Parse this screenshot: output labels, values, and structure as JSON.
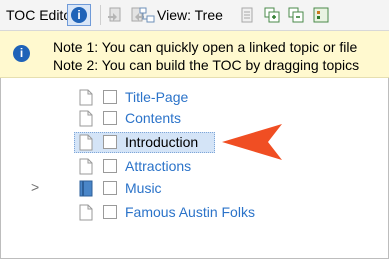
{
  "toolbar": {
    "title": "TOC Editor",
    "view_label": "View: Tree",
    "icons": [
      "info-icon",
      "topic-left-icon",
      "topic-right-icon",
      "view-tree-icon",
      "list-icon",
      "expand-icon",
      "collapse-icon"
    ]
  },
  "note": {
    "line1": "Note 1: You can quickly open a linked topic or file",
    "line2": "Note 2: You can build the TOC by dragging topics"
  },
  "tree": {
    "items": [
      {
        "label": "Title-Page",
        "icon": "document-icon",
        "selected": false,
        "expandable": false
      },
      {
        "label": "Contents",
        "icon": "document-icon",
        "selected": false,
        "expandable": false
      },
      {
        "label": "Introduction",
        "icon": "document-icon",
        "selected": true,
        "expandable": false
      },
      {
        "label": "Attractions",
        "icon": "document-icon",
        "selected": false,
        "expandable": false
      },
      {
        "label": "Music",
        "icon": "book-icon",
        "selected": false,
        "expandable": true
      },
      {
        "label": "Famous Austin Folks",
        "icon": "document-icon",
        "selected": false,
        "expandable": false
      }
    ],
    "expander_glyph": ">"
  },
  "colors": {
    "link": "#2b73c9",
    "selection": "#d4e4f7",
    "note_bg": "#fff9cf",
    "arrow": "#f04e23",
    "info_blue": "#1f63b8"
  }
}
